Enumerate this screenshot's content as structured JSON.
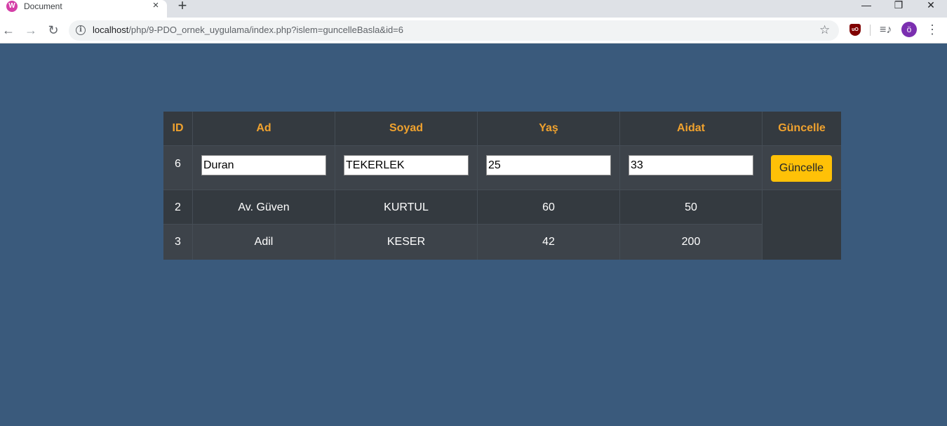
{
  "browser": {
    "tab_title": "Document",
    "tab_close": "×",
    "new_tab": "+",
    "url_host": "localhost",
    "url_path": "/php/9-PDO_ornek_uygulama/index.php?islem=guncelleBasla&id=6",
    "profile_initial": "ö",
    "favicon_letter": "W",
    "icons": [
      "back-icon",
      "forward-icon",
      "reload-icon",
      "info-icon",
      "star-icon",
      "ublock-icon",
      "media-icon",
      "menu-icon"
    ],
    "window_buttons": {
      "minimize": "—",
      "restore": "❐",
      "close": "✕"
    }
  },
  "table": {
    "headers": [
      "ID",
      "Ad",
      "Soyad",
      "Yaş",
      "Aidat",
      "Güncelle"
    ],
    "edit_row": {
      "id": "6",
      "ad": "Duran",
      "soyad": "TEKERLEK",
      "yas": "25",
      "aidat": "33",
      "button_label": "Güncelle"
    },
    "rows": [
      {
        "id": "2",
        "ad": "Av. Güven",
        "soyad": "KURTUL",
        "yas": "60",
        "aidat": "50"
      },
      {
        "id": "3",
        "ad": "Adil",
        "soyad": "KESER",
        "yas": "42",
        "aidat": "200"
      }
    ]
  },
  "colors": {
    "page_background": "#3a5a7c",
    "table_background": "#343a40",
    "header_text": "#f0a22e",
    "button_background": "#ffc107"
  }
}
